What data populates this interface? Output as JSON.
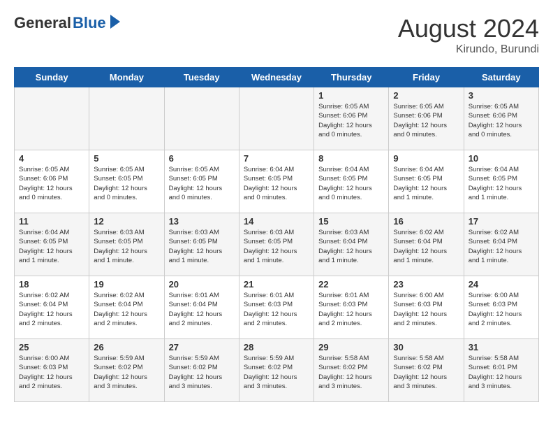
{
  "header": {
    "logo_general": "General",
    "logo_blue": "Blue",
    "month_title": "August 2024",
    "location": "Kirundo, Burundi"
  },
  "days_of_week": [
    "Sunday",
    "Monday",
    "Tuesday",
    "Wednesday",
    "Thursday",
    "Friday",
    "Saturday"
  ],
  "weeks": [
    [
      {
        "day": "",
        "info": ""
      },
      {
        "day": "",
        "info": ""
      },
      {
        "day": "",
        "info": ""
      },
      {
        "day": "",
        "info": ""
      },
      {
        "day": "1",
        "info": "Sunrise: 6:05 AM\nSunset: 6:06 PM\nDaylight: 12 hours\nand 0 minutes."
      },
      {
        "day": "2",
        "info": "Sunrise: 6:05 AM\nSunset: 6:06 PM\nDaylight: 12 hours\nand 0 minutes."
      },
      {
        "day": "3",
        "info": "Sunrise: 6:05 AM\nSunset: 6:06 PM\nDaylight: 12 hours\nand 0 minutes."
      }
    ],
    [
      {
        "day": "4",
        "info": "Sunrise: 6:05 AM\nSunset: 6:06 PM\nDaylight: 12 hours\nand 0 minutes."
      },
      {
        "day": "5",
        "info": "Sunrise: 6:05 AM\nSunset: 6:05 PM\nDaylight: 12 hours\nand 0 minutes."
      },
      {
        "day": "6",
        "info": "Sunrise: 6:05 AM\nSunset: 6:05 PM\nDaylight: 12 hours\nand 0 minutes."
      },
      {
        "day": "7",
        "info": "Sunrise: 6:04 AM\nSunset: 6:05 PM\nDaylight: 12 hours\nand 0 minutes."
      },
      {
        "day": "8",
        "info": "Sunrise: 6:04 AM\nSunset: 6:05 PM\nDaylight: 12 hours\nand 0 minutes."
      },
      {
        "day": "9",
        "info": "Sunrise: 6:04 AM\nSunset: 6:05 PM\nDaylight: 12 hours\nand 1 minute."
      },
      {
        "day": "10",
        "info": "Sunrise: 6:04 AM\nSunset: 6:05 PM\nDaylight: 12 hours\nand 1 minute."
      }
    ],
    [
      {
        "day": "11",
        "info": "Sunrise: 6:04 AM\nSunset: 6:05 PM\nDaylight: 12 hours\nand 1 minute."
      },
      {
        "day": "12",
        "info": "Sunrise: 6:03 AM\nSunset: 6:05 PM\nDaylight: 12 hours\nand 1 minute."
      },
      {
        "day": "13",
        "info": "Sunrise: 6:03 AM\nSunset: 6:05 PM\nDaylight: 12 hours\nand 1 minute."
      },
      {
        "day": "14",
        "info": "Sunrise: 6:03 AM\nSunset: 6:05 PM\nDaylight: 12 hours\nand 1 minute."
      },
      {
        "day": "15",
        "info": "Sunrise: 6:03 AM\nSunset: 6:04 PM\nDaylight: 12 hours\nand 1 minute."
      },
      {
        "day": "16",
        "info": "Sunrise: 6:02 AM\nSunset: 6:04 PM\nDaylight: 12 hours\nand 1 minute."
      },
      {
        "day": "17",
        "info": "Sunrise: 6:02 AM\nSunset: 6:04 PM\nDaylight: 12 hours\nand 1 minute."
      }
    ],
    [
      {
        "day": "18",
        "info": "Sunrise: 6:02 AM\nSunset: 6:04 PM\nDaylight: 12 hours\nand 2 minutes."
      },
      {
        "day": "19",
        "info": "Sunrise: 6:02 AM\nSunset: 6:04 PM\nDaylight: 12 hours\nand 2 minutes."
      },
      {
        "day": "20",
        "info": "Sunrise: 6:01 AM\nSunset: 6:04 PM\nDaylight: 12 hours\nand 2 minutes."
      },
      {
        "day": "21",
        "info": "Sunrise: 6:01 AM\nSunset: 6:03 PM\nDaylight: 12 hours\nand 2 minutes."
      },
      {
        "day": "22",
        "info": "Sunrise: 6:01 AM\nSunset: 6:03 PM\nDaylight: 12 hours\nand 2 minutes."
      },
      {
        "day": "23",
        "info": "Sunrise: 6:00 AM\nSunset: 6:03 PM\nDaylight: 12 hours\nand 2 minutes."
      },
      {
        "day": "24",
        "info": "Sunrise: 6:00 AM\nSunset: 6:03 PM\nDaylight: 12 hours\nand 2 minutes."
      }
    ],
    [
      {
        "day": "25",
        "info": "Sunrise: 6:00 AM\nSunset: 6:03 PM\nDaylight: 12 hours\nand 2 minutes."
      },
      {
        "day": "26",
        "info": "Sunrise: 5:59 AM\nSunset: 6:02 PM\nDaylight: 12 hours\nand 3 minutes."
      },
      {
        "day": "27",
        "info": "Sunrise: 5:59 AM\nSunset: 6:02 PM\nDaylight: 12 hours\nand 3 minutes."
      },
      {
        "day": "28",
        "info": "Sunrise: 5:59 AM\nSunset: 6:02 PM\nDaylight: 12 hours\nand 3 minutes."
      },
      {
        "day": "29",
        "info": "Sunrise: 5:58 AM\nSunset: 6:02 PM\nDaylight: 12 hours\nand 3 minutes."
      },
      {
        "day": "30",
        "info": "Sunrise: 5:58 AM\nSunset: 6:02 PM\nDaylight: 12 hours\nand 3 minutes."
      },
      {
        "day": "31",
        "info": "Sunrise: 5:58 AM\nSunset: 6:01 PM\nDaylight: 12 hours\nand 3 minutes."
      }
    ]
  ]
}
